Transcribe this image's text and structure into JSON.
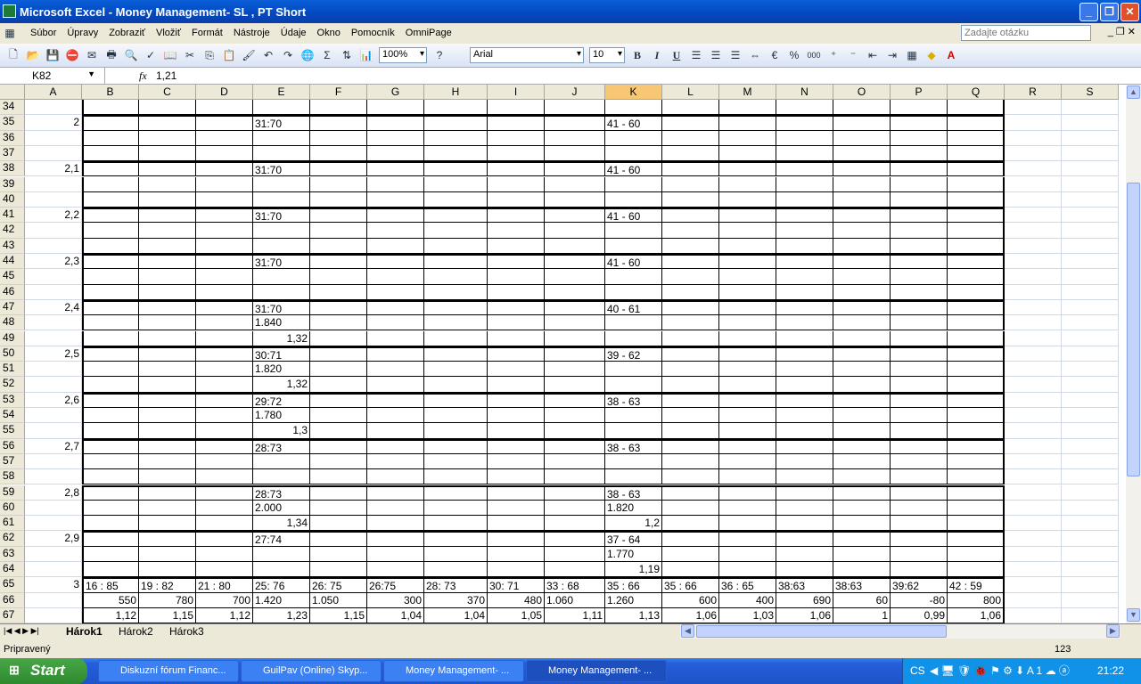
{
  "window": {
    "title": "Microsoft Excel - Money Management- SL , PT Short"
  },
  "menu": [
    "Súbor",
    "Úpravy",
    "Zobraziť",
    "Vložiť",
    "Formát",
    "Nástroje",
    "Údaje",
    "Okno",
    "Pomocník",
    "OmniPage"
  ],
  "ask_placeholder": "Zadajte otázku",
  "toolbar": {
    "zoom": "100%",
    "font": "Arial",
    "size": "10",
    "bold": "B",
    "italic": "I",
    "underline": "U",
    "percent": "%",
    "thousands": "000"
  },
  "formula": {
    "name_box": "K82",
    "fx": "fx",
    "value": "1,21"
  },
  "columns": [
    "A",
    "B",
    "C",
    "D",
    "E",
    "F",
    "G",
    "H",
    "I",
    "J",
    "K",
    "L",
    "M",
    "N",
    "O",
    "P",
    "Q",
    "R",
    "S"
  ],
  "active_column": "K",
  "rows": {
    "34": {},
    "35": {
      "A": "2",
      "E": "31:70",
      "K": "41 - 60"
    },
    "36": {},
    "37": {},
    "38": {
      "A": "2,1",
      "E": "31:70",
      "K": "41 - 60"
    },
    "39": {},
    "40": {},
    "41": {
      "A": "2,2",
      "E": "31:70",
      "K": "41 - 60"
    },
    "42": {},
    "43": {},
    "44": {
      "A": "2,3",
      "E": "31:70",
      "K": "41 - 60"
    },
    "45": {},
    "46": {},
    "47": {
      "A": "2,4",
      "E": "31:70",
      "K": "40 - 61"
    },
    "48": {
      "E": "1.840"
    },
    "49": {
      "E": "1,32"
    },
    "50": {
      "A": "2,5",
      "E": "30:71",
      "K": "39 - 62"
    },
    "51": {
      "E": "1.820"
    },
    "52": {
      "E": "1,32"
    },
    "53": {
      "A": "2,6",
      "E": "29:72",
      "K": "38 - 63"
    },
    "54": {
      "E": "1.780"
    },
    "55": {
      "E": "1,3"
    },
    "56": {
      "A": "2,7",
      "E": "28:73",
      "K": "38 - 63"
    },
    "57": {},
    "58": {},
    "59": {
      "A": "2,8",
      "E": "28:73",
      "K": "38 - 63"
    },
    "60": {
      "E": "2.000",
      "K": "1.820"
    },
    "61": {
      "E": "1,34",
      "K": "1,2"
    },
    "62": {
      "A": "2,9",
      "E": "27:74",
      "K": "37 - 64"
    },
    "63": {
      "K": "1.770"
    },
    "64": {
      "K": "1,19"
    },
    "65": {
      "A": "3",
      "B": "16 : 85",
      "C": "19 : 82",
      "D": "21 : 80",
      "E": "25: 76",
      "F": "26: 75",
      "G": "26:75",
      "H": "28: 73",
      "I": "30: 71",
      "J": "33 : 68",
      "K": "35 : 66",
      "L": "35 : 66",
      "M": "36 : 65",
      "N": "38:63",
      "O": "38:63",
      "P": "39:62",
      "Q": "42 : 59"
    },
    "66": {
      "B": "550",
      "C": "780",
      "D": "700",
      "E": "1.420",
      "F": "1.050",
      "G": "300",
      "H": "370",
      "I": "480",
      "J": "1.060",
      "K": "1.260",
      "L": "600",
      "M": "400",
      "N": "690",
      "O": "60",
      "P": "-80",
      "Q": "800"
    },
    "67": {
      "B": "1,12",
      "C": "1,15",
      "D": "1,12",
      "E": "1,23",
      "F": "1,15",
      "G": "1,04",
      "H": "1,04",
      "I": "1,05",
      "J": "1,11",
      "K": "1,13",
      "L": "1,06",
      "M": "1,03",
      "N": "1,06",
      "O": "1",
      "P": "0,99",
      "Q": "1,06"
    }
  },
  "sheets": [
    "Hárok1",
    "Hárok2",
    "Hárok3"
  ],
  "status": {
    "ready": "Pripravený",
    "num": "123"
  },
  "taskbar": {
    "start": "Start",
    "tasks": [
      "Diskuzní fórum Financ...",
      "GuilPav (Online) Skyp...",
      "Money Management- ...",
      "Money Management- ..."
    ],
    "lang": "CS",
    "clock": "21:22"
  }
}
